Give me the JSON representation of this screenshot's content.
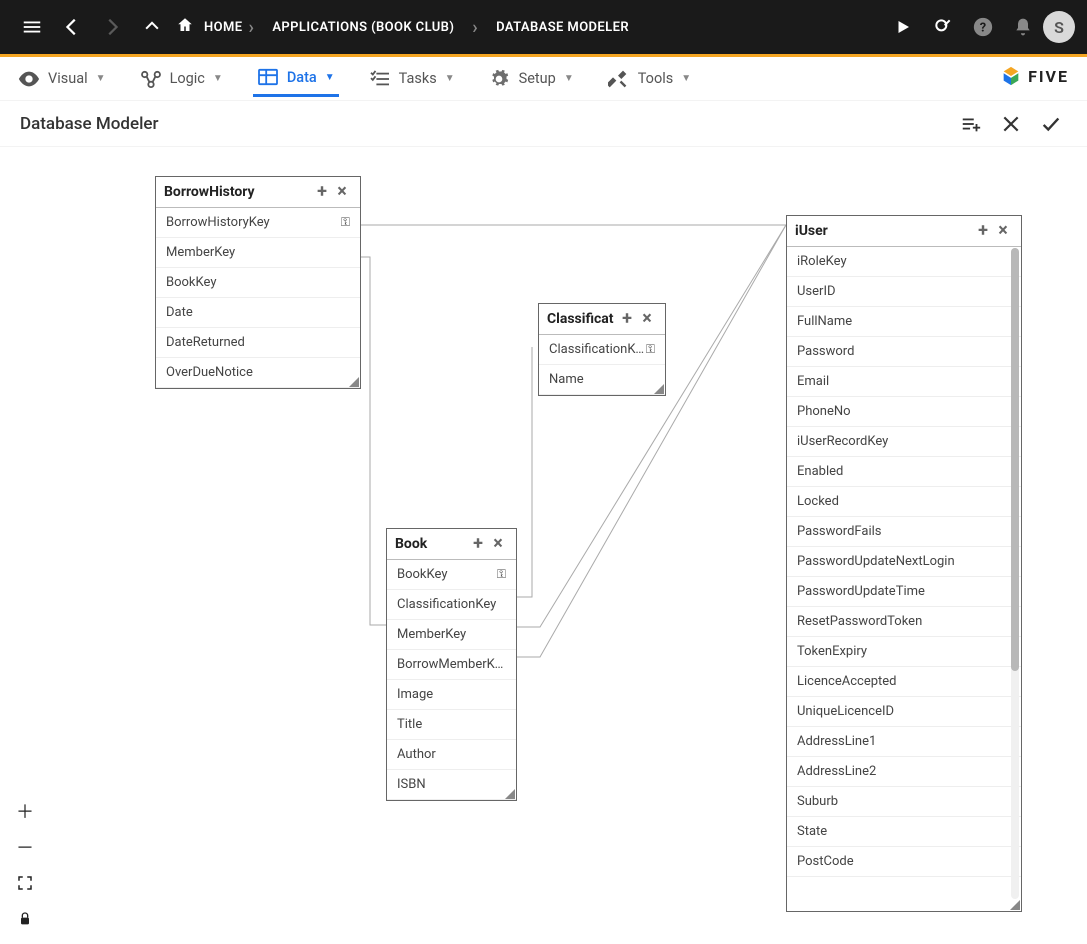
{
  "topbar": {
    "home": "HOME",
    "crumb_app": "APPLICATIONS (BOOK CLUB)",
    "crumb_page": "DATABASE MODELER",
    "avatar_letter": "S"
  },
  "tabs": {
    "visual": "Visual",
    "logic": "Logic",
    "data": "Data",
    "tasks": "Tasks",
    "setup": "Setup",
    "tools": "Tools"
  },
  "brand": "FIVE",
  "page_title": "Database Modeler",
  "tables": {
    "borrowHistory": {
      "name": "BorrowHistory",
      "fields": [
        "BorrowHistoryKey",
        "MemberKey",
        "BookKey",
        "Date",
        "DateReturned",
        "OverDueNotice"
      ],
      "keyIndex": 0
    },
    "classification": {
      "name": "Classificat",
      "fields": [
        "ClassificationKey",
        "Name"
      ],
      "keyIndex": 0
    },
    "book": {
      "name": "Book",
      "fields": [
        "BookKey",
        "ClassificationKey",
        "MemberKey",
        "BorrowMemberKey",
        "Image",
        "Title",
        "Author",
        "ISBN"
      ],
      "keyIndex": 0
    },
    "iuser": {
      "name": "iUser",
      "fields": [
        "iRoleKey",
        "UserID",
        "FullName",
        "Password",
        "Email",
        "PhoneNo",
        "iUserRecordKey",
        "Enabled",
        "Locked",
        "PasswordFails",
        "PasswordUpdateNextLogin",
        "PasswordUpdateTime",
        "ResetPasswordToken",
        "TokenExpiry",
        "LicenceAccepted",
        "UniqueLicenceID",
        "AddressLine1",
        "AddressLine2",
        "Suburb",
        "State",
        "PostCode"
      ]
    }
  }
}
